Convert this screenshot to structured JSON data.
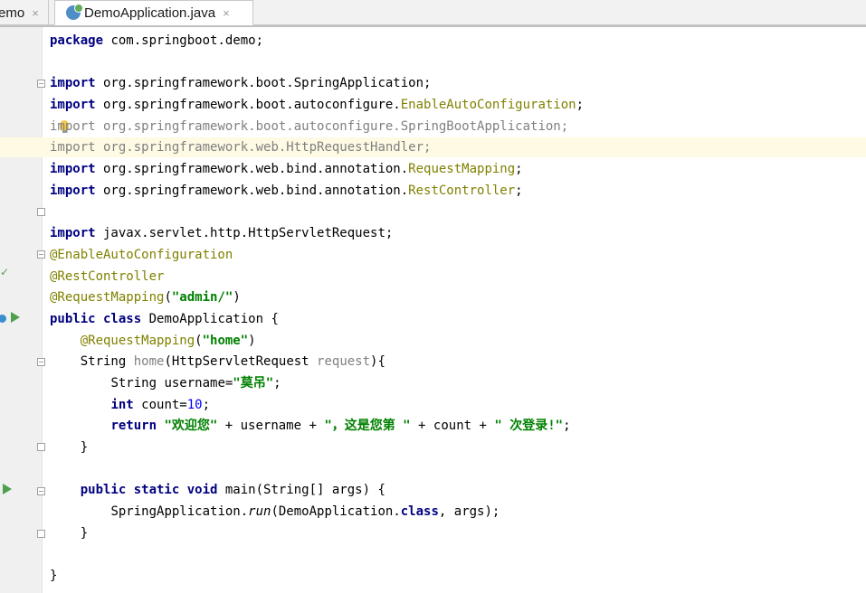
{
  "tabs": [
    {
      "label": "emo",
      "close": "×"
    },
    {
      "label": "DemoApplication.java",
      "close": "×"
    }
  ],
  "code": {
    "l1": {
      "kw": "package",
      "rest": " com.springboot.demo;"
    },
    "l3": {
      "kw": "import",
      "rest": " org.springframework.boot.SpringApplication;"
    },
    "l4": {
      "kw": "import",
      "pre": " org.springframework.boot.autoconfigure.",
      "cls": "EnableAutoConfiguration",
      "end": ";"
    },
    "l5": {
      "kw": "import",
      "rest": " org.springframework.boot.autoconfigure.SpringBootApplication;"
    },
    "l6": {
      "kw": "import",
      "rest": " org.springframework.web.HttpRequestHandler;"
    },
    "l7": {
      "kw": "import",
      "pre": " org.springframework.web.bind.annotation.",
      "cls": "RequestMapping",
      "end": ";"
    },
    "l8": {
      "kw": "import",
      "pre": " org.springframework.web.bind.annotation.",
      "cls": "RestController",
      "end": ";"
    },
    "l10": {
      "kw": "import",
      "rest": " javax.servlet.http.HttpServletRequest;"
    },
    "l11": {
      "ann": "@EnableAutoConfiguration"
    },
    "l12": {
      "ann": "@RestController"
    },
    "l13": {
      "ann": "@RequestMapping",
      "open": "(",
      "str": "\"admin/\"",
      "close": ")"
    },
    "l14": {
      "kw": "public class",
      "rest": " DemoApplication {"
    },
    "l15": {
      "ann": "@RequestMapping",
      "open": "(",
      "str": "\"home\"",
      "close": ")"
    },
    "l16": {
      "type": "String ",
      "name": "home",
      "open": "(HttpServletRequest ",
      "param": "request",
      "close": "){"
    },
    "l17": {
      "pre": "String username=",
      "str": "\"莫吊\"",
      "end": ";"
    },
    "l18": {
      "kw": "int",
      "pre": " count=",
      "num": "10",
      "end": ";"
    },
    "l19": {
      "kw": "return",
      "s1": " \"欢迎您\"",
      "p1": " + username + ",
      "s2": "\"，这是您第 \"",
      "p2": " + count + ",
      "s3": "\" 次登录!\"",
      "end": ";"
    },
    "l20": {
      "text": "}"
    },
    "l22": {
      "kw": "public static void",
      "pre": " main(String[] args) {"
    },
    "l23": {
      "pre": "SpringApplication.",
      "run": "run",
      "mid": "(DemoApplication.",
      "kw": "class",
      "end": ", args);"
    },
    "l24": {
      "text": "}"
    },
    "l26": {
      "text": "}"
    }
  }
}
